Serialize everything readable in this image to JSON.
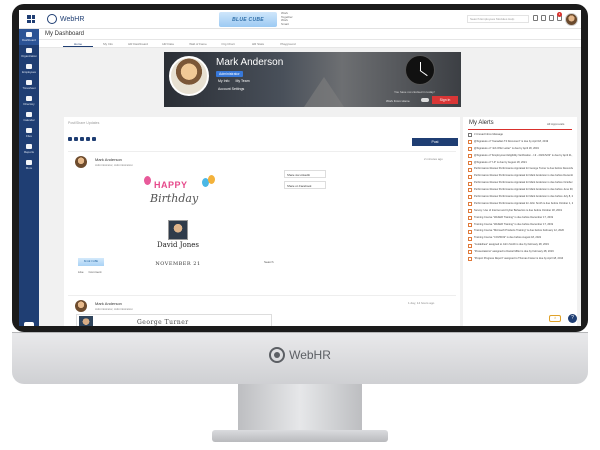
{
  "app": {
    "name": "WebHR",
    "chin_brand": "WebHR"
  },
  "topbar": {
    "company_logo_text": "BLUE CUBE",
    "tagline": "Work Together Work Smart",
    "search_placeholder": "Search Employees Modules Help",
    "notification_count": "1"
  },
  "sidebar": {
    "items": [
      {
        "label": "Dashboard"
      },
      {
        "label": "Organization"
      },
      {
        "label": "Employees"
      },
      {
        "label": "Timesheet"
      },
      {
        "label": "Directory"
      },
      {
        "label": "Calendar"
      },
      {
        "label": "Files"
      },
      {
        "label": "Reports"
      },
      {
        "label": "More"
      }
    ]
  },
  "page": {
    "title": "My Dashboard"
  },
  "tabs": [
    "Home",
    "My Info",
    "HR Dashboard",
    "HR Data",
    "Wall of Fame",
    "Org Chart",
    "HR Stats",
    "Playground"
  ],
  "profile": {
    "name": "Mark Anderson",
    "role": "Administrator",
    "link_info": "My Info",
    "link_team": "My Team",
    "link_settings": "Account Settings",
    "clock_status": "You have not clocked in today!",
    "work_from_home": "Work From Home",
    "sign_in": "Sign in"
  },
  "feed": {
    "post_placeholder": "Post/Share Updates",
    "post_button": "Post",
    "post1": {
      "author": "Mark Anderson",
      "subtitle": "Administrator, Administration",
      "time": "2 minutes ago",
      "share_linkedin": "Share via LinkedIn",
      "share_facebook": "Share on Facebook",
      "happy": "HAPPY",
      "birthday": "Birthday",
      "person": "David Jones",
      "date": "NOVEMBER 21",
      "logo_text": "BLUE CUBE",
      "like": "Like",
      "comment": "Comment",
      "search": "Search"
    },
    "post2": {
      "author": "Mark Anderson",
      "subtitle": "Administrator, Administration",
      "time": "1 day, 14 hours ago",
      "person": "George Turner"
    }
  },
  "alerts": {
    "title": "My Alerts",
    "all_link": "All Approvals",
    "items": [
      {
        "text": "3 Unread Inbox Message",
        "tone": "gray"
      },
      {
        "text": "@Signature of \"Canadian T4 Document\" is due by April 18, 2019",
        "tone": "orange"
      },
      {
        "text": "@Signature of \"Job Offer Letter\" is due by April 18, 2019",
        "tone": "orange"
      },
      {
        "text": "@Signature of \"Employment Eligibility Verification - I-9 - 2020-5/22\" is due by April 21, 2020",
        "tone": "orange"
      },
      {
        "text": "@Signature of \"I-9\" is due by August 18, 2021",
        "tone": "orange"
      },
      {
        "text": "Performance Review Performance Appraisal for George Turner is due before December 24, 2019",
        "tone": "orange"
      },
      {
        "text": "Performance Review Performance Appraisal for Mark Anderson is due before December 16, 2019",
        "tone": "orange"
      },
      {
        "text": "Performance Review Performance Appraisal for Mark Anderson is due before October 31, 2020",
        "tone": "orange"
      },
      {
        "text": "Performance Review Performance Appraisal for Mark Anderson is due before June 30, 2021",
        "tone": "orange"
      },
      {
        "text": "Performance Review Performance Appraisal for Mark Anderson is due before July 8, 2021",
        "tone": "orange"
      },
      {
        "text": "Performance Review Performance Appraisal for John Smith is due before October 1, 2021",
        "tone": "orange"
      },
      {
        "text": "Survey: Use of Internet and Cyber Behaviors is due before October 18, 2019",
        "tone": "orange"
      },
      {
        "text": "Training Course \"WebHR Training\" is due before December 17, 2019",
        "tone": "orange"
      },
      {
        "text": "Training Course \"WebHR Training\" is due before December 17, 2019",
        "tone": "orange"
      },
      {
        "text": "Training Course \"Microsoft Products Training\" is due before February 12, 2020",
        "tone": "orange"
      },
      {
        "text": "Training Course \"COVID19\" is due before August 18, 2021",
        "tone": "orange"
      },
      {
        "text": "\"Guidelines\" assigned to John Smith is due by February 28, 2019",
        "tone": "orange"
      },
      {
        "text": "\"Presentations\" assigned to Daniel Miller is due by February 28, 2019",
        "tone": "orange"
      },
      {
        "text": "\"Project Progress Report\" assigned to Thomas Foster is due by April 18, 2019",
        "tone": "orange"
      }
    ]
  },
  "colors": {
    "brand": "#1f3e73",
    "accent_red": "#d9302c",
    "role_badge": "#3778d9"
  }
}
